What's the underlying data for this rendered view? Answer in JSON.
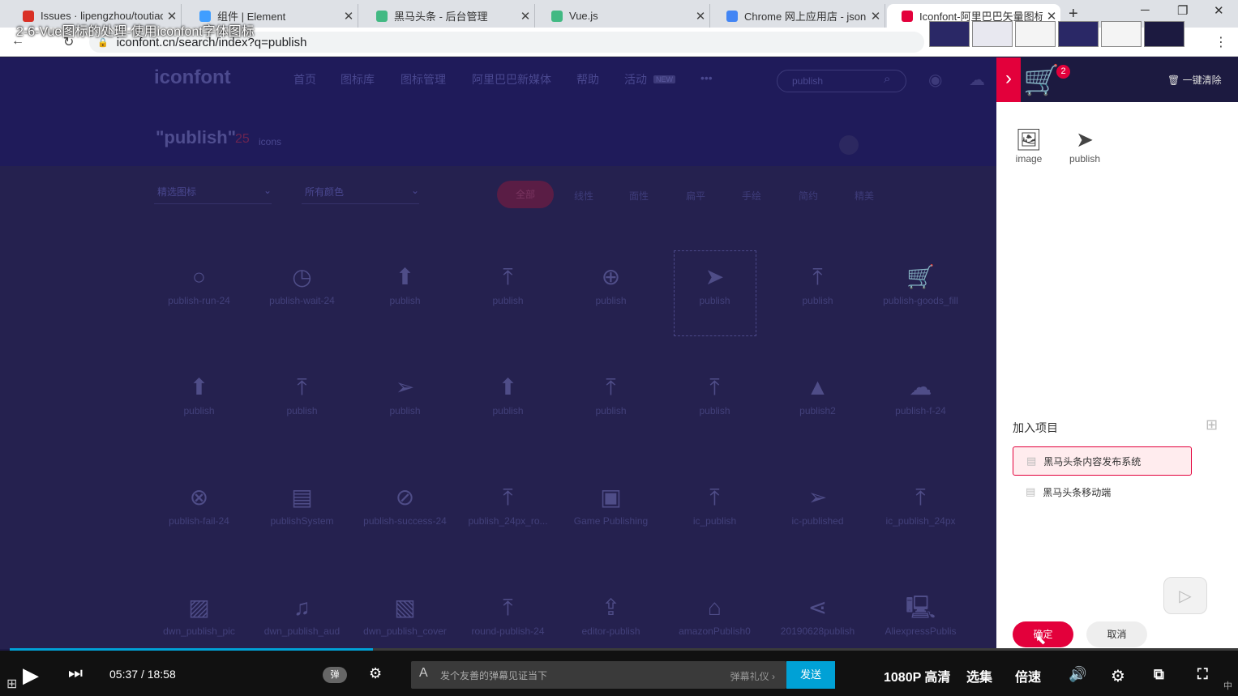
{
  "browser": {
    "tabs": [
      {
        "title": "Issues · lipengzhou/toutiao",
        "icon_color": "#d93025"
      },
      {
        "title": "组件 | Element",
        "icon_color": "#409eff"
      },
      {
        "title": "黑马头条 - 后台管理",
        "icon_color": "#42b983"
      },
      {
        "title": "Vue.js",
        "icon_color": "#42b983"
      },
      {
        "title": "Chrome 网上应用店 - json",
        "icon_color": "#4285f4"
      },
      {
        "title": "Iconfont-阿里巴巴矢量图标",
        "icon_color": "#e3003b"
      }
    ],
    "close_glyph": "✕",
    "new_tab": "+",
    "url": "iconfont.cn/search/index?q=publish",
    "minimize": "─",
    "maximize": "❐",
    "close": "✕"
  },
  "video_title_overlay": "2-6-Vue图标的处理-使用iconfont字体图标",
  "site": {
    "logo": "iconfont",
    "nav": [
      "首页",
      "图标库",
      "图标管理",
      "阿里巴巴新媒体",
      "帮助",
      "活动"
    ],
    "nav_badge": "NEW",
    "nav_more": "•••",
    "search_value": "publish",
    "result_title": "\"publish\"",
    "result_count": "25",
    "result_label": "icons",
    "filter_selects": [
      "精选图标",
      "所有颜色"
    ],
    "filter_chips": [
      "全部",
      "线性",
      "面性",
      "扁平",
      "手绘",
      "简约",
      "精美"
    ]
  },
  "icon_grid": [
    [
      {
        "name": "publish-run-24",
        "icon": "○"
      },
      {
        "name": "publish-wait-24",
        "icon": "◷"
      },
      {
        "name": "publish",
        "icon": "⬆"
      },
      {
        "name": "publish",
        "icon": "⤒"
      },
      {
        "name": "publish",
        "icon": "⊕"
      },
      {
        "name": "publish",
        "icon": "➤"
      },
      {
        "name": "publish",
        "icon": "⤒"
      },
      {
        "name": "publish-goods_fill",
        "icon": "🛒"
      }
    ],
    [
      {
        "name": "publish",
        "icon": "⬆"
      },
      {
        "name": "publish",
        "icon": "⤒"
      },
      {
        "name": "publish",
        "icon": "➢"
      },
      {
        "name": "publish",
        "icon": "⬆"
      },
      {
        "name": "publish",
        "icon": "⤒"
      },
      {
        "name": "publish",
        "icon": "⤒"
      },
      {
        "name": "publish2",
        "icon": "▲"
      },
      {
        "name": "publish-f-24",
        "icon": "☁"
      }
    ],
    [
      {
        "name": "publish-fail-24",
        "icon": "⊗"
      },
      {
        "name": "publishSystem",
        "icon": "▤"
      },
      {
        "name": "publish-success-24",
        "icon": "⊘"
      },
      {
        "name": "publish_24px_ro...",
        "icon": "⤒"
      },
      {
        "name": "Game Publishing",
        "icon": "▣"
      },
      {
        "name": "ic_publish",
        "icon": "⤒"
      },
      {
        "name": "ic-published",
        "icon": "➢"
      },
      {
        "name": "ic_publish_24px",
        "icon": "⤒"
      }
    ],
    [
      {
        "name": "dwn_publish_pic",
        "icon": "▨"
      },
      {
        "name": "dwn_publish_aud",
        "icon": "♫"
      },
      {
        "name": "dwn_publish_cover",
        "icon": "▧"
      },
      {
        "name": "round-publish-24",
        "icon": "⤒"
      },
      {
        "name": "editor-publish",
        "icon": "⇪"
      },
      {
        "name": "amazonPublish0",
        "icon": "⌂"
      },
      {
        "name": "20190628publish",
        "icon": "⋖"
      },
      {
        "name": "AliexpressPublis",
        "icon": "🖳"
      }
    ]
  ],
  "cart": {
    "toggle_icon": "›",
    "badge": "2",
    "clear_label": "一键清除",
    "items": [
      {
        "name": "image",
        "icon": "🖼"
      },
      {
        "name": "publish",
        "icon": "➤"
      }
    ],
    "project_header": "加入项目",
    "projects": [
      "黑马头条内容发布系统",
      "黑马头条移动端"
    ],
    "ok_label": "确定",
    "cancel_label": "取消"
  },
  "player": {
    "current_time": "05:37",
    "separator": "/",
    "duration": "18:58",
    "progress_fraction": 0.296,
    "danmu_toggle": "弹",
    "danmu_placeholder": "发个友善的弹幕见证当下",
    "danmu_etiquette": "弹幕礼仪 ›",
    "send_label": "发送",
    "quality": "1080P 高清",
    "episodes": "选集",
    "speed": "倍速",
    "ime": "中"
  }
}
